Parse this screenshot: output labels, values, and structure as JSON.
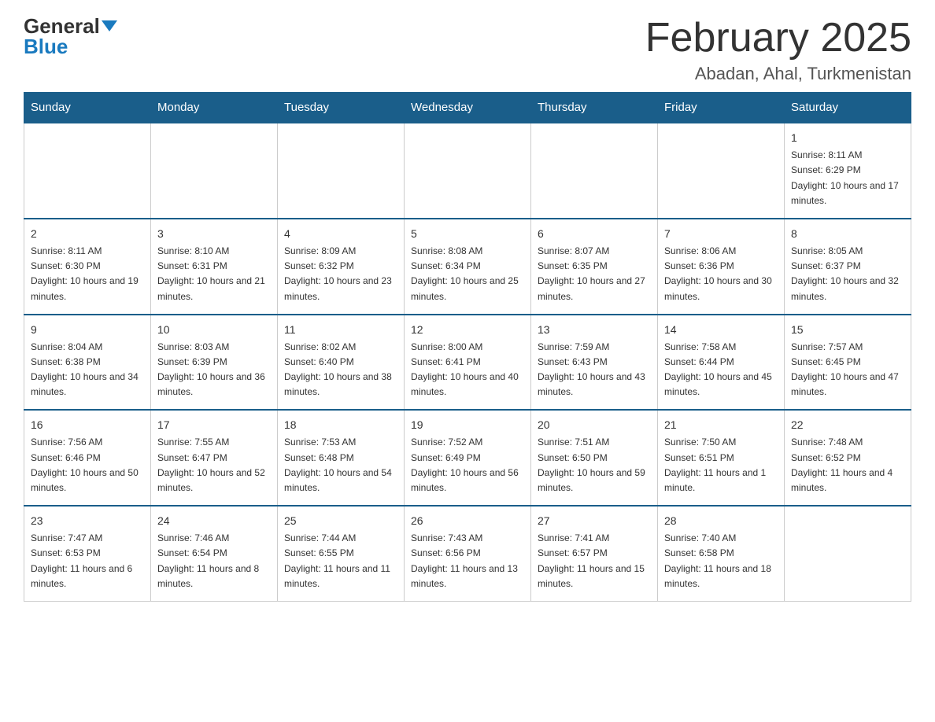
{
  "logo": {
    "general": "General",
    "blue": "Blue"
  },
  "title": "February 2025",
  "subtitle": "Abadan, Ahal, Turkmenistan",
  "days_of_week": [
    "Sunday",
    "Monday",
    "Tuesday",
    "Wednesday",
    "Thursday",
    "Friday",
    "Saturday"
  ],
  "weeks": [
    [
      {
        "day": "",
        "sunrise": "",
        "sunset": "",
        "daylight": ""
      },
      {
        "day": "",
        "sunrise": "",
        "sunset": "",
        "daylight": ""
      },
      {
        "day": "",
        "sunrise": "",
        "sunset": "",
        "daylight": ""
      },
      {
        "day": "",
        "sunrise": "",
        "sunset": "",
        "daylight": ""
      },
      {
        "day": "",
        "sunrise": "",
        "sunset": "",
        "daylight": ""
      },
      {
        "day": "",
        "sunrise": "",
        "sunset": "",
        "daylight": ""
      },
      {
        "day": "1",
        "sunrise": "Sunrise: 8:11 AM",
        "sunset": "Sunset: 6:29 PM",
        "daylight": "Daylight: 10 hours and 17 minutes."
      }
    ],
    [
      {
        "day": "2",
        "sunrise": "Sunrise: 8:11 AM",
        "sunset": "Sunset: 6:30 PM",
        "daylight": "Daylight: 10 hours and 19 minutes."
      },
      {
        "day": "3",
        "sunrise": "Sunrise: 8:10 AM",
        "sunset": "Sunset: 6:31 PM",
        "daylight": "Daylight: 10 hours and 21 minutes."
      },
      {
        "day": "4",
        "sunrise": "Sunrise: 8:09 AM",
        "sunset": "Sunset: 6:32 PM",
        "daylight": "Daylight: 10 hours and 23 minutes."
      },
      {
        "day": "5",
        "sunrise": "Sunrise: 8:08 AM",
        "sunset": "Sunset: 6:34 PM",
        "daylight": "Daylight: 10 hours and 25 minutes."
      },
      {
        "day": "6",
        "sunrise": "Sunrise: 8:07 AM",
        "sunset": "Sunset: 6:35 PM",
        "daylight": "Daylight: 10 hours and 27 minutes."
      },
      {
        "day": "7",
        "sunrise": "Sunrise: 8:06 AM",
        "sunset": "Sunset: 6:36 PM",
        "daylight": "Daylight: 10 hours and 30 minutes."
      },
      {
        "day": "8",
        "sunrise": "Sunrise: 8:05 AM",
        "sunset": "Sunset: 6:37 PM",
        "daylight": "Daylight: 10 hours and 32 minutes."
      }
    ],
    [
      {
        "day": "9",
        "sunrise": "Sunrise: 8:04 AM",
        "sunset": "Sunset: 6:38 PM",
        "daylight": "Daylight: 10 hours and 34 minutes."
      },
      {
        "day": "10",
        "sunrise": "Sunrise: 8:03 AM",
        "sunset": "Sunset: 6:39 PM",
        "daylight": "Daylight: 10 hours and 36 minutes."
      },
      {
        "day": "11",
        "sunrise": "Sunrise: 8:02 AM",
        "sunset": "Sunset: 6:40 PM",
        "daylight": "Daylight: 10 hours and 38 minutes."
      },
      {
        "day": "12",
        "sunrise": "Sunrise: 8:00 AM",
        "sunset": "Sunset: 6:41 PM",
        "daylight": "Daylight: 10 hours and 40 minutes."
      },
      {
        "day": "13",
        "sunrise": "Sunrise: 7:59 AM",
        "sunset": "Sunset: 6:43 PM",
        "daylight": "Daylight: 10 hours and 43 minutes."
      },
      {
        "day": "14",
        "sunrise": "Sunrise: 7:58 AM",
        "sunset": "Sunset: 6:44 PM",
        "daylight": "Daylight: 10 hours and 45 minutes."
      },
      {
        "day": "15",
        "sunrise": "Sunrise: 7:57 AM",
        "sunset": "Sunset: 6:45 PM",
        "daylight": "Daylight: 10 hours and 47 minutes."
      }
    ],
    [
      {
        "day": "16",
        "sunrise": "Sunrise: 7:56 AM",
        "sunset": "Sunset: 6:46 PM",
        "daylight": "Daylight: 10 hours and 50 minutes."
      },
      {
        "day": "17",
        "sunrise": "Sunrise: 7:55 AM",
        "sunset": "Sunset: 6:47 PM",
        "daylight": "Daylight: 10 hours and 52 minutes."
      },
      {
        "day": "18",
        "sunrise": "Sunrise: 7:53 AM",
        "sunset": "Sunset: 6:48 PM",
        "daylight": "Daylight: 10 hours and 54 minutes."
      },
      {
        "day": "19",
        "sunrise": "Sunrise: 7:52 AM",
        "sunset": "Sunset: 6:49 PM",
        "daylight": "Daylight: 10 hours and 56 minutes."
      },
      {
        "day": "20",
        "sunrise": "Sunrise: 7:51 AM",
        "sunset": "Sunset: 6:50 PM",
        "daylight": "Daylight: 10 hours and 59 minutes."
      },
      {
        "day": "21",
        "sunrise": "Sunrise: 7:50 AM",
        "sunset": "Sunset: 6:51 PM",
        "daylight": "Daylight: 11 hours and 1 minute."
      },
      {
        "day": "22",
        "sunrise": "Sunrise: 7:48 AM",
        "sunset": "Sunset: 6:52 PM",
        "daylight": "Daylight: 11 hours and 4 minutes."
      }
    ],
    [
      {
        "day": "23",
        "sunrise": "Sunrise: 7:47 AM",
        "sunset": "Sunset: 6:53 PM",
        "daylight": "Daylight: 11 hours and 6 minutes."
      },
      {
        "day": "24",
        "sunrise": "Sunrise: 7:46 AM",
        "sunset": "Sunset: 6:54 PM",
        "daylight": "Daylight: 11 hours and 8 minutes."
      },
      {
        "day": "25",
        "sunrise": "Sunrise: 7:44 AM",
        "sunset": "Sunset: 6:55 PM",
        "daylight": "Daylight: 11 hours and 11 minutes."
      },
      {
        "day": "26",
        "sunrise": "Sunrise: 7:43 AM",
        "sunset": "Sunset: 6:56 PM",
        "daylight": "Daylight: 11 hours and 13 minutes."
      },
      {
        "day": "27",
        "sunrise": "Sunrise: 7:41 AM",
        "sunset": "Sunset: 6:57 PM",
        "daylight": "Daylight: 11 hours and 15 minutes."
      },
      {
        "day": "28",
        "sunrise": "Sunrise: 7:40 AM",
        "sunset": "Sunset: 6:58 PM",
        "daylight": "Daylight: 11 hours and 18 minutes."
      },
      {
        "day": "",
        "sunrise": "",
        "sunset": "",
        "daylight": ""
      }
    ]
  ]
}
